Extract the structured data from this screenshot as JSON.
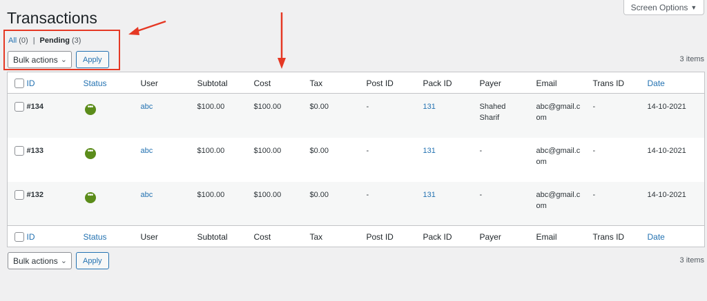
{
  "page": {
    "title": "Transactions"
  },
  "screen_options": {
    "label": "Screen Options",
    "icon": "caret-down-icon"
  },
  "filters": {
    "all": {
      "label": "All",
      "count": "(0)"
    },
    "separator": "|",
    "pending": {
      "label": "Pending",
      "count": "(3)"
    }
  },
  "bulk": {
    "select_value": "Bulk actions",
    "apply_label": "Apply"
  },
  "items_count": "3 items",
  "table": {
    "columns": [
      "ID",
      "Status",
      "User",
      "Subtotal",
      "Cost",
      "Tax",
      "Post ID",
      "Pack ID",
      "Payer",
      "Email",
      "Trans ID",
      "Date"
    ],
    "rows": [
      {
        "id": "#134",
        "status": "pending",
        "user": "abc",
        "subtotal": "$100.00",
        "cost": "$100.00",
        "tax": "$0.00",
        "post_id": "-",
        "pack_id": "131",
        "payer_line1": "Shahed",
        "payer_line2": "Sharif",
        "email_line1": "abc@gmail.c",
        "email_line2": "om",
        "trans_id": "-",
        "date": "14-10-2021"
      },
      {
        "id": "#133",
        "status": "pending",
        "user": "abc",
        "subtotal": "$100.00",
        "cost": "$100.00",
        "tax": "$0.00",
        "post_id": "-",
        "pack_id": "131",
        "payer_line1": "-",
        "payer_line2": "",
        "email_line1": "abc@gmail.c",
        "email_line2": "om",
        "trans_id": "-",
        "date": "14-10-2021"
      },
      {
        "id": "#132",
        "status": "pending",
        "user": "abc",
        "subtotal": "$100.00",
        "cost": "$100.00",
        "tax": "$0.00",
        "post_id": "-",
        "pack_id": "131",
        "payer_line1": "-",
        "payer_line2": "",
        "email_line1": "abc@gmail.c",
        "email_line2": "om",
        "trans_id": "-",
        "date": "14-10-2021"
      }
    ]
  },
  "colors": {
    "link": "#2271b1",
    "status_pending": "#5b8c1a",
    "annotation": "#e53824"
  }
}
